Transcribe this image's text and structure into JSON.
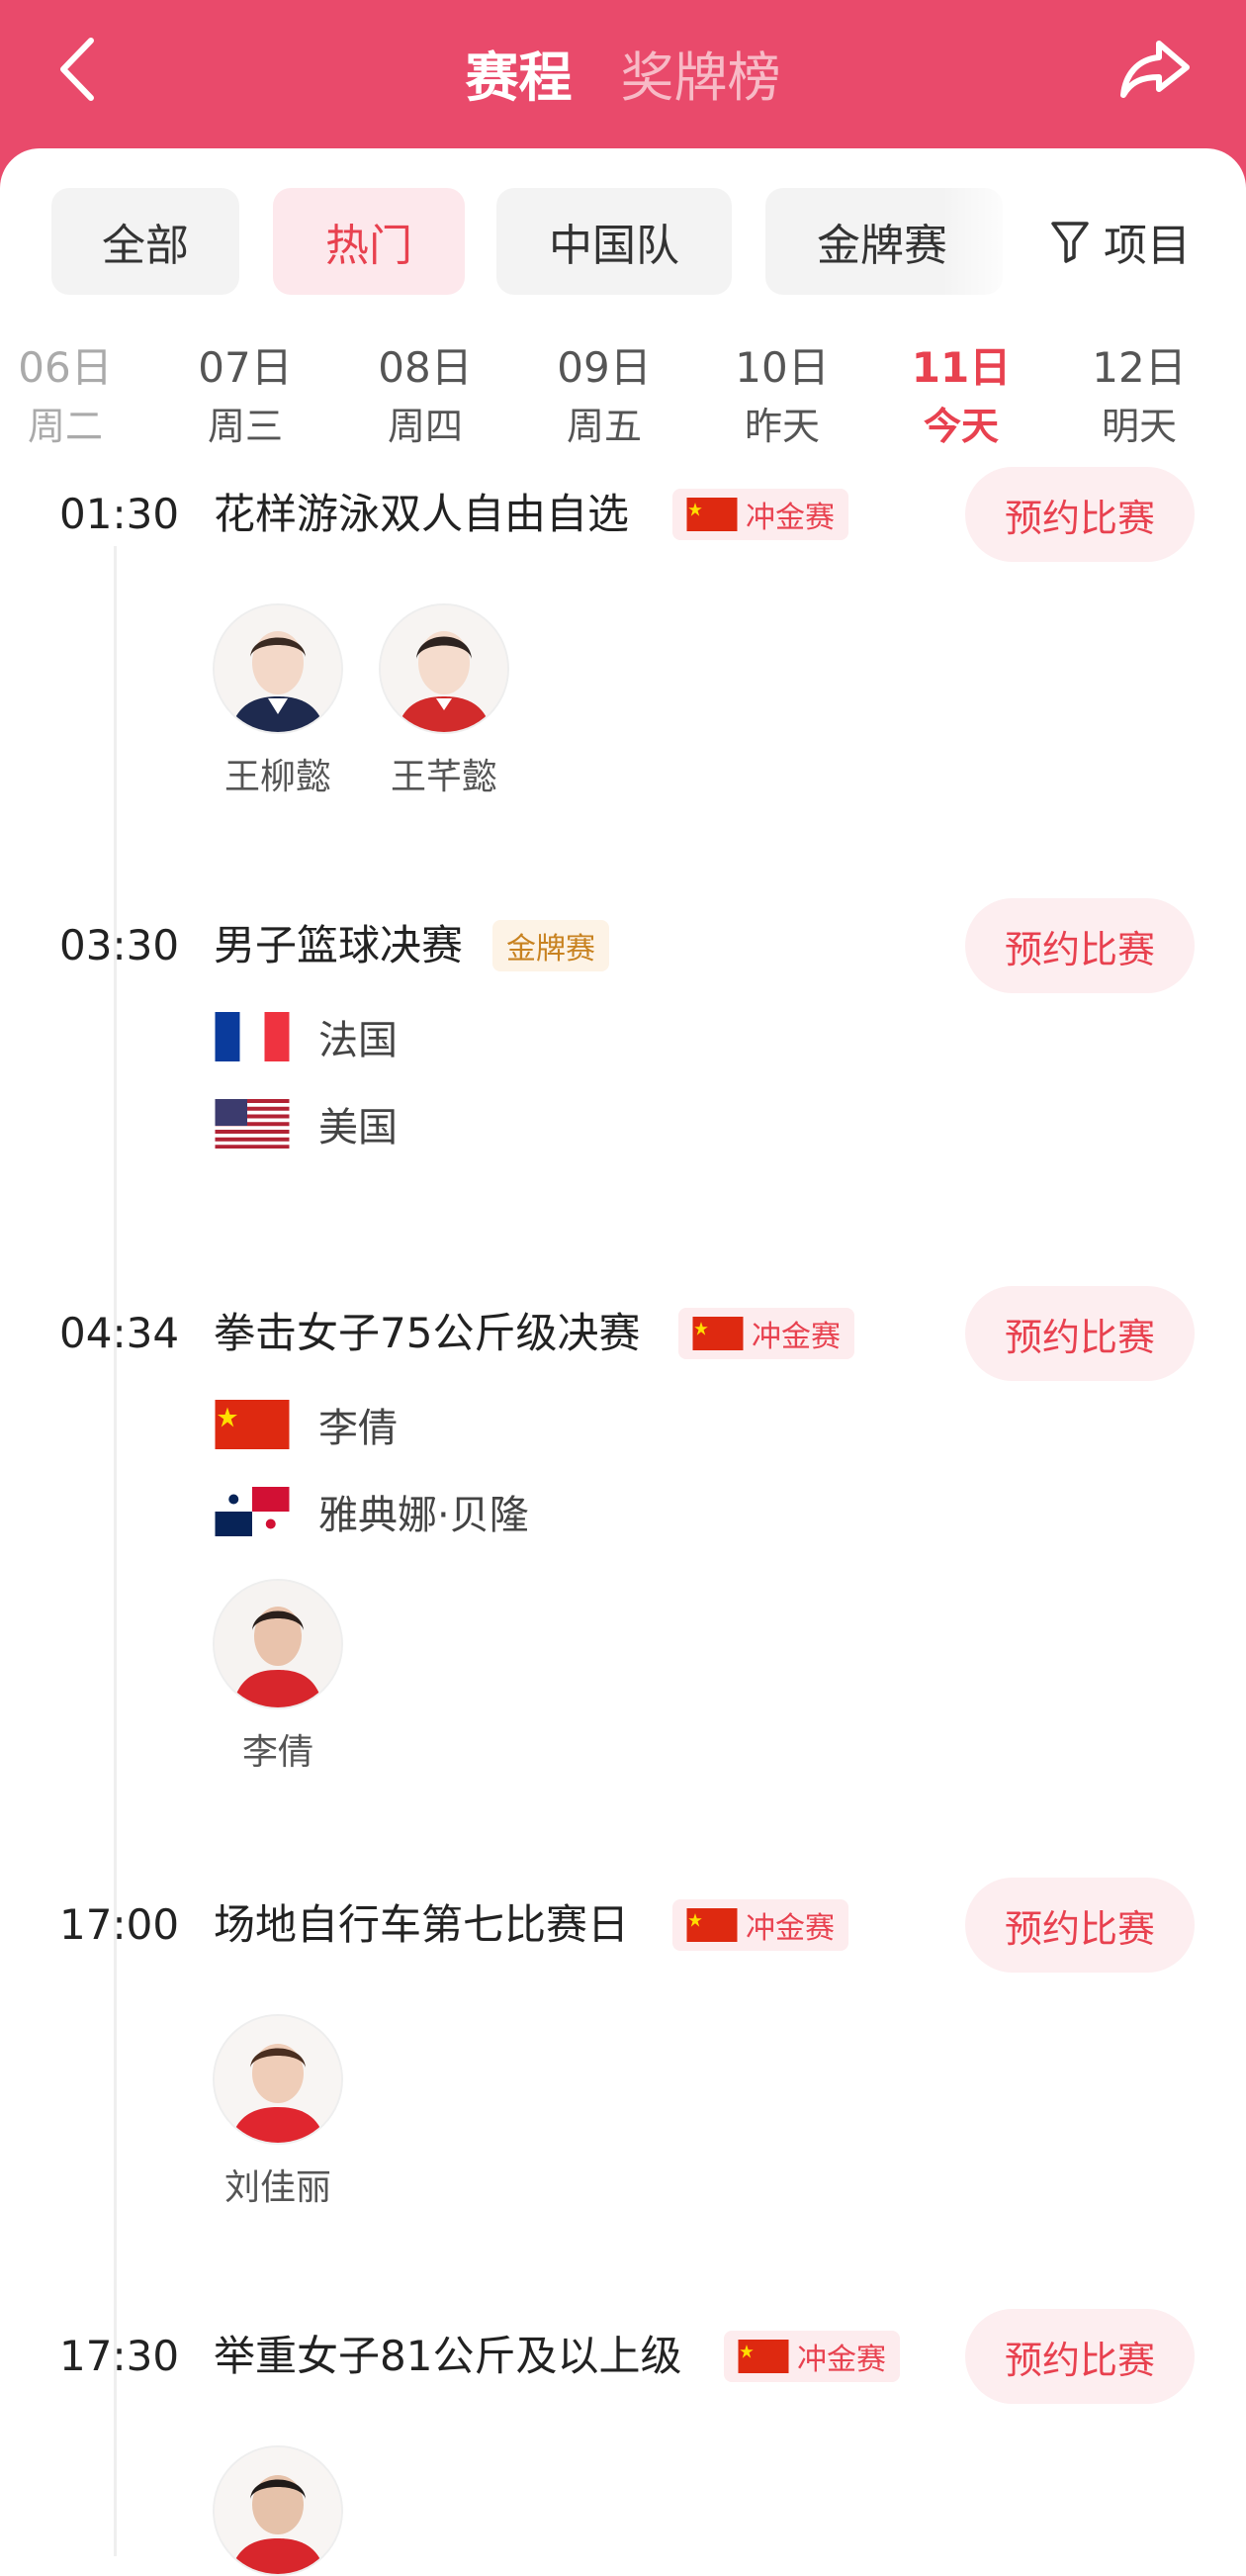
{
  "header": {
    "tabs": [
      "赛程",
      "奖牌榜"
    ],
    "active_tab": 0
  },
  "filters": {
    "chips": [
      "全部",
      "热门",
      "中国队",
      "金牌赛"
    ],
    "active_chip": 1,
    "project_label": "项目"
  },
  "dates": [
    {
      "day": "06日",
      "week": "周二"
    },
    {
      "day": "07日",
      "week": "周三"
    },
    {
      "day": "08日",
      "week": "周四"
    },
    {
      "day": "09日",
      "week": "周五"
    },
    {
      "day": "10日",
      "week": "昨天"
    },
    {
      "day": "11日",
      "week": "今天"
    },
    {
      "day": "12日",
      "week": "明天"
    }
  ],
  "selected_date_index": 5,
  "book_label": "预约比赛",
  "events": [
    {
      "time": "01:30",
      "title": "花样游泳双人自由自选",
      "badge": "冲金赛",
      "athletes": [
        "王柳懿",
        "王芊懿"
      ]
    },
    {
      "time": "03:30",
      "title": "男子篮球决赛",
      "badge": "金牌赛",
      "teams": [
        "法国",
        "美国"
      ]
    },
    {
      "time": "04:34",
      "title": "拳击女子75公斤级决赛",
      "badge": "冲金赛",
      "teams": [
        "李倩",
        "雅典娜·贝隆"
      ],
      "athletes": [
        "李倩"
      ]
    },
    {
      "time": "17:00",
      "title": "场地自行车第七比赛日",
      "badge": "冲金赛",
      "athletes": [
        "刘佳丽"
      ]
    },
    {
      "time": "17:30",
      "title": "举重女子81公斤及以上级",
      "badge": "冲金赛",
      "athletes": []
    }
  ],
  "colors": {
    "brand": "#e94a6b",
    "accent": "#e8414f",
    "gold_text": "#c88220"
  }
}
